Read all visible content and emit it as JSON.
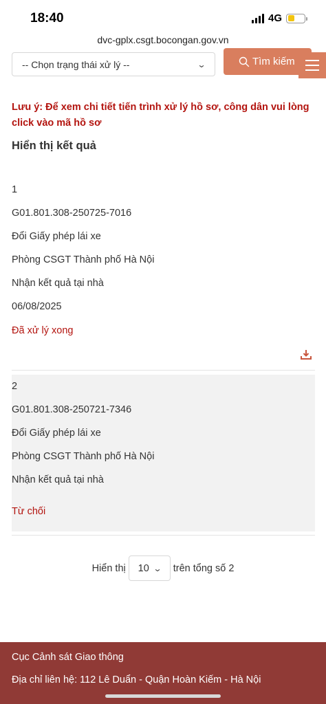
{
  "status_bar": {
    "time": "18:40",
    "network": "4G"
  },
  "browser": {
    "url": "dvc-gplx.csgt.bocongan.gov.vn"
  },
  "filter": {
    "status_select_value": "-- Chọn trạng thái xử lý --"
  },
  "search": {
    "button_label": "Tìm kiếm"
  },
  "note": "Lưu ý: Để xem chi tiết tiến trình xử lý hồ sơ, công dân vui lòng click vào mã hồ sơ",
  "results_heading": "Hiển thị kết quả",
  "records": [
    {
      "index": "1",
      "code": "G01.801.308-250725-7016",
      "service": "Đổi Giấy phép lái xe",
      "agency": "Phòng CSGT Thành phố Hà Nội",
      "delivery": "Nhận kết quả tại nhà",
      "date": "06/08/2025",
      "status": "Đã xử lý xong"
    },
    {
      "index": "2",
      "code": "G01.801.308-250721-7346",
      "service": "Đổi Giấy phép lái xe",
      "agency": "Phòng CSGT Thành phố Hà Nội",
      "delivery": "Nhận kết quả tại nhà",
      "status": "Từ chối"
    }
  ],
  "pagination": {
    "prefix": "Hiển thị",
    "page_size": "10",
    "suffix": "trên tổng số 2"
  },
  "footer": {
    "title": "Cục Cảnh sát Giao thông",
    "address": "Địa chỉ liên hệ: 112 Lê Duẩn - Quận Hoàn Kiếm - Hà Nội"
  },
  "colors": {
    "accent": "#d97e5e",
    "alert_red": "#b3140f",
    "footer_bg": "#903a36",
    "battery": "#f2c40f"
  },
  "icons": [
    "signal-icon",
    "battery-icon",
    "chevron-down-icon",
    "search-icon",
    "menu-icon",
    "download-icon"
  ]
}
